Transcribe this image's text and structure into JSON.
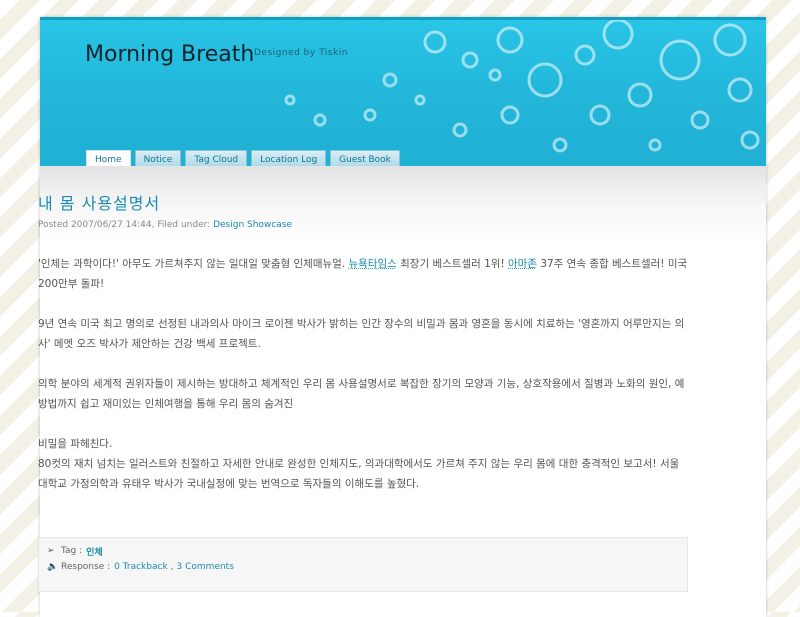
{
  "header": {
    "site_title": "Morning Breath",
    "tagline": "Designed by Tiskin",
    "accent_color": "#22b6d9"
  },
  "nav": {
    "tabs": [
      {
        "label": "Home"
      },
      {
        "label": "Notice"
      },
      {
        "label": "Tag Cloud"
      },
      {
        "label": "Location Log"
      },
      {
        "label": "Guest Book"
      }
    ],
    "active": "Home"
  },
  "post": {
    "title": "내 몸 사용설명서",
    "meta_prefix": "Posted 2007/06/27 14:44, Filed under:",
    "category": "Design Showcase",
    "p1_a": "'인체는 과학이다!' 아무도 가르쳐주지 않는 일대일 맞춤형 인체매뉴얼. ",
    "p1_link1": "뉴욕타임스",
    "p1_b": " 최장기 베스트셀러 1위! ",
    "p1_link2": "아마존",
    "p1_c": " 37주 연속 종합 베스트셀러! 미국 200만부 돌파!",
    "p2": "9년 연속 미국 최고 명의로 선정된 내과의사 마이크 로이젠 박사가 밝히는 인간 장수의 비밀과 몸과 영혼을 동시에 치료하는 '영혼까지 어루만지는 의사' 메멧 오즈 박사가 제안하는 건강 백세 프로젝트.",
    "p3": "의학 분야의 세계적 권위자들이 제시하는 방대하고 체계적인 우리 몸 사용설명서로 복잡한 장기의 모양과 기능, 상호작용에서 질병과 노화의 원인, 예방법까지 쉽고 재미있는 인체여행을 통해 우리 몸의 숨겨진",
    "p4_line1": "비밀을 파헤친다.",
    "p4_line2": "80컷의 재치 넘치는 일러스트와 친절하고 자세한 안내로 완성한 인체지도, 의과대학에서도 가르쳐 주지 않는 우리 몸에 대한 충격적인 보고서! 서울대학교 가정의학과 유태우 박사가 국내실정에 맞는 번역으로 독자들의 이해도를 높혔다."
  },
  "footer": {
    "tag_label": "Tag :",
    "tag_value": "인체",
    "response_label": "Response :",
    "trackback": "0 Trackback",
    "separator": ",",
    "comments": "3 Comments"
  }
}
